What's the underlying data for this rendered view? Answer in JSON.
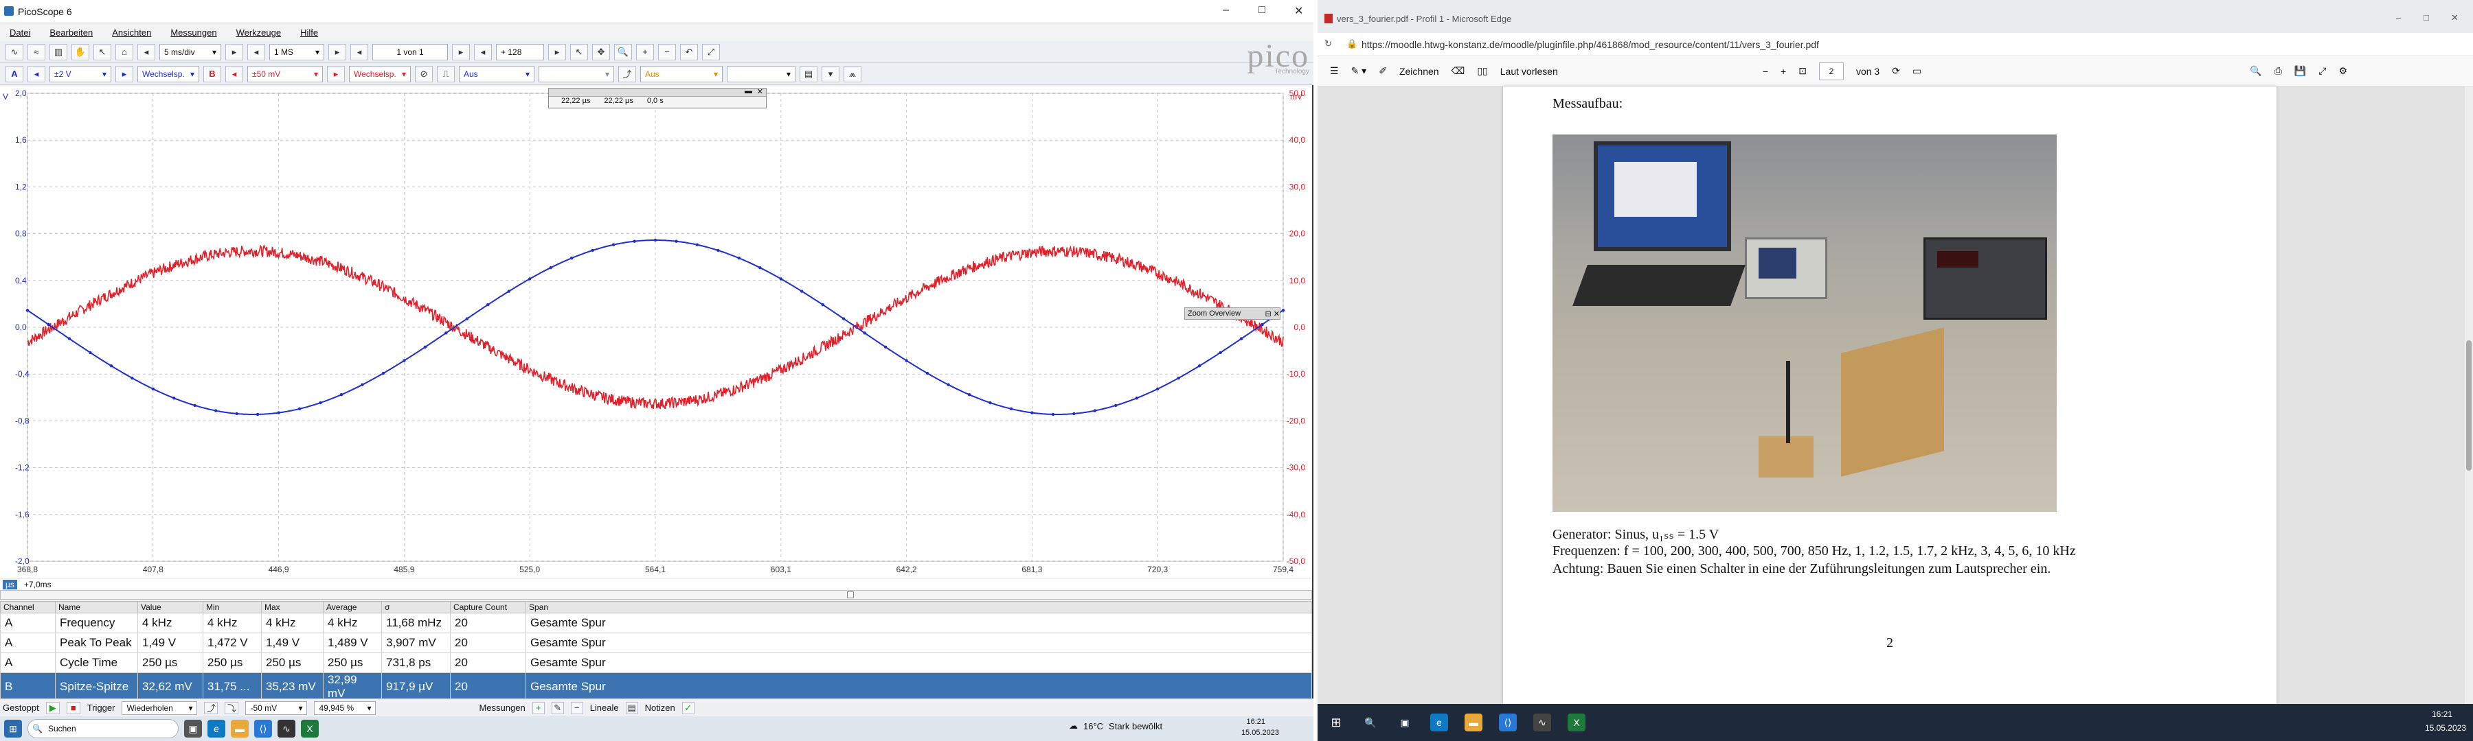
{
  "pico": {
    "title": "PicoScope 6",
    "menu": [
      "Datei",
      "Bearbeiten",
      "Ansichten",
      "Messungen",
      "Werkzeuge",
      "Hilfe"
    ],
    "toolbar1": {
      "timebase": "5 ms/div",
      "samples": "1 MS",
      "capture": "1 von 1",
      "captures": "+ 128"
    },
    "toolbar2": {
      "chA_range": "±2 V",
      "chA_coupling": "Wechselsp.",
      "chB_range": "±50 mV",
      "chB_coupling": "Wechselsp.",
      "trigger_mode": "Aus",
      "trigger_mode2": "Aus"
    },
    "logo": "pico",
    "logo_sub": "Technology",
    "scope": {
      "y_left_unit": "V",
      "y_right_unit": "mV",
      "y_left_ticks": [
        "2,0",
        "1,6",
        "1,2",
        "0,8",
        "0,4",
        "0,0",
        "-0,4",
        "-0,8",
        "-1,2",
        "-1,6",
        "-2,0"
      ],
      "y_right_ticks": [
        "50,0",
        "40,0",
        "30,0",
        "20,0",
        "10,0",
        "0,0",
        "-10,0",
        "-20,0",
        "-30,0",
        "-40,0",
        "-50,0"
      ],
      "x_ticks": [
        "368,8",
        "407,8",
        "446,9",
        "485,9",
        "525,0",
        "564,1",
        "603,1",
        "642,2",
        "681,3",
        "720,3",
        "759,4"
      ],
      "x_unit": "µs",
      "x_offset": "+7,0ms",
      "ruler": {
        "v1": "22,22 µs",
        "v2": "22,22 µs",
        "v3": "0,0 s"
      },
      "zoom_overview": "Zoom Overview",
      "series_A_color": "#1f2fcf",
      "series_B_color": "#e0202a"
    },
    "measurements": {
      "headers": [
        "Channel",
        "Name",
        "Value",
        "Min",
        "Max",
        "Average",
        "σ",
        "Capture Count",
        "Span"
      ],
      "rows": [
        [
          "A",
          "Frequency",
          "4 kHz",
          "4 kHz",
          "4 kHz",
          "4 kHz",
          "11,68 mHz",
          "20",
          "Gesamte Spur"
        ],
        [
          "A",
          "Peak To Peak",
          "1,49 V",
          "1,472 V",
          "1,49 V",
          "1,489 V",
          "3,907 mV",
          "20",
          "Gesamte Spur"
        ],
        [
          "A",
          "Cycle Time",
          "250 µs",
          "250 µs",
          "250 µs",
          "250 µs",
          "731,8 ps",
          "20",
          "Gesamte Spur"
        ],
        [
          "B",
          "Spitze-Spitze",
          "32,62 mV",
          "31,75 ...",
          "35,23 mV",
          "32,99 mV",
          "917,9 µV",
          "20",
          "Gesamte Spur"
        ]
      ]
    },
    "status": {
      "state": "Gestoppt",
      "trigger_label": "Trigger",
      "trigger_value": "Wiederholen",
      "level": "-50 mV",
      "percent": "49,945 %",
      "measurements_label": "Messungen",
      "rulers_label": "Lineale",
      "notes_label": "Notizen"
    },
    "taskbar": {
      "search": "Suchen",
      "time": "16:21",
      "date": "15.05.2023"
    }
  },
  "edge": {
    "tab_title": "vers_3_fourier.pdf - Profil 1 - Microsoft Edge",
    "url": "https://moodle.htwg-konstanz.de/moodle/pluginfile.php/461868/mod_resource/content/11/vers_3_fourier.pdf",
    "toolbar": {
      "draw": "Zeichnen",
      "read_aloud": "Laut vorlesen",
      "page": "2",
      "of_pages": "von 3"
    },
    "doc": {
      "heading": "Messaufbau:",
      "generator": "Generator: Sinus, u₁ₛₛ = 1.5 V",
      "frequencies": "Frequenzen: f = 100, 200, 300, 400, 500, 700, 850 Hz, 1, 1.2, 1.5, 1.7, 2 kHz, 3, 4, 5, 6, 10 kHz",
      "warning": "Achtung: Bauen Sie einen Schalter in eine der Zuführungsleitungen zum Lautsprecher ein.",
      "page_number": "2"
    },
    "taskbar": {
      "weather": "16°C",
      "weather_text": "Stark bewölkt",
      "time": "16:21",
      "date": "15.05.2023"
    }
  }
}
